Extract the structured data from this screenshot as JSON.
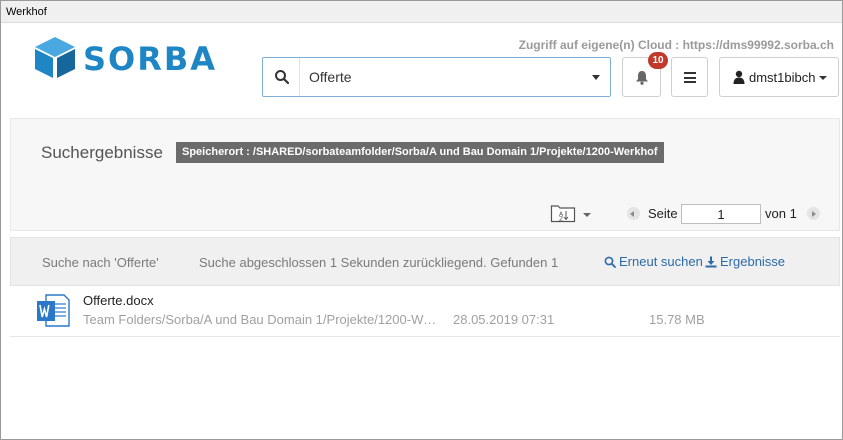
{
  "window": {
    "title": "Werkhof"
  },
  "header": {
    "brand": "SORBA",
    "cloud_link": "Zugriff auf eigene(n) Cloud : https://dms99992.sorba.ch",
    "search": {
      "value": "Offerte"
    },
    "notifications": {
      "count": "10"
    },
    "user": {
      "name": "dmst1bibch"
    }
  },
  "results": {
    "title": "Suchergebnisse",
    "location": "Speicherort : /SHARED/sorbateamfolder/Sorba/A und Bau Domain 1/Projekte/1200-Werkhof",
    "pagination": {
      "page_label": "Seite",
      "page_value": "1",
      "of_label": "von 1"
    }
  },
  "status": {
    "query_text": "Suche nach 'Offerte'",
    "summary_text": "Suche abgeschlossen 1 Sekunden zurückliegend. Gefunden 1",
    "retry_label": "Erneut suchen",
    "download_label": "Ergebnisse"
  },
  "files": [
    {
      "name": "Offerte.docx",
      "path": "Team Folders/Sorba/A und Bau Domain 1/Projekte/1200-Werkhof",
      "date": "28.05.2019 07:31",
      "size": "15.78 MB",
      "icon": "word-document-icon"
    }
  ],
  "colors": {
    "brand_blue": "#1f86c6",
    "badge_red": "#c0392b",
    "link_blue": "#2c6aa8",
    "location_bg": "#6b6b6b"
  }
}
